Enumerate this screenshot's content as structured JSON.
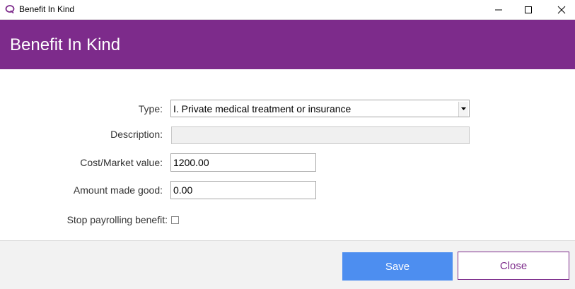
{
  "window": {
    "title": "Benefit In Kind",
    "icon": "q-logo-icon"
  },
  "header": {
    "title": "Benefit In Kind",
    "color": "#7d2b8b"
  },
  "form": {
    "type_label": "Type:",
    "type_value": "I. Private medical treatment or insurance",
    "description_label": "Description:",
    "description_value": "",
    "cost_label": "Cost/Market value:",
    "cost_value": "1200.00",
    "amount_label": "Amount made good:",
    "amount_value": "0.00",
    "stop_label": "Stop payrolling benefit:",
    "stop_checked": false
  },
  "footer": {
    "save_label": "Save",
    "close_label": "Close",
    "save_color": "#4d8ef0"
  }
}
